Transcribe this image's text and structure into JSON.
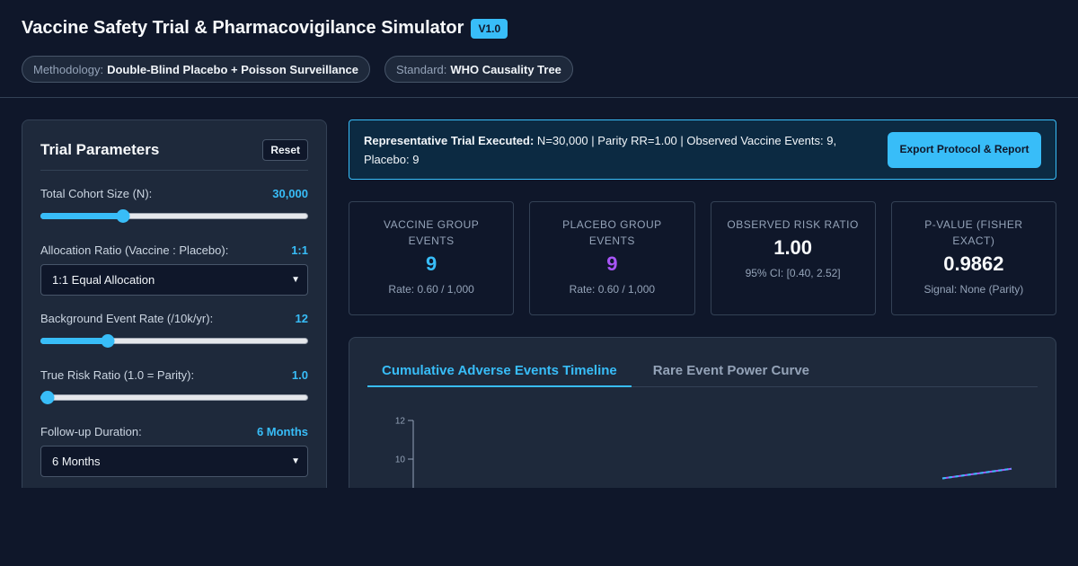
{
  "header": {
    "title": "Vaccine Safety Trial & Pharmacovigilance Simulator",
    "version": "V1.0",
    "pills": [
      {
        "label": "Methodology:",
        "value": "Double-Blind Placebo + Poisson Surveillance"
      },
      {
        "label": "Standard:",
        "value": "WHO Causality Tree"
      }
    ]
  },
  "sidebar": {
    "title": "Trial Parameters",
    "reset_label": "Reset",
    "params": {
      "cohort": {
        "label": "Total Cohort Size (N):",
        "value": "30,000",
        "fraction": 0.3
      },
      "allocation": {
        "label": "Allocation Ratio (Vaccine : Placebo):",
        "value": "1:1",
        "selected": "1:1 Equal Allocation"
      },
      "background": {
        "label": "Background Event Rate (/10k/yr):",
        "value": "12",
        "fraction": 0.24
      },
      "risk": {
        "label": "True Risk Ratio (1.0 = Parity):",
        "value": "1.0",
        "fraction": 0.0
      },
      "followup": {
        "label": "Follow-up Duration:",
        "value": "6 Months",
        "selected": "6 Months"
      }
    }
  },
  "banner": {
    "bold": "Representative Trial Executed:",
    "text": " N=30,000 | Parity RR=1.00 | Observed Vaccine Events: 9, Placebo: 9",
    "export_label": "Export Protocol & Report"
  },
  "cards": [
    {
      "label": "Vaccine Group Events",
      "value": "9",
      "sub": "Rate: 0.60 / 1,000",
      "color": "#38bdf8"
    },
    {
      "label": "Placebo Group Events",
      "value": "9",
      "sub": "Rate: 0.60 / 1,000",
      "color": "#a855f7"
    },
    {
      "label": "Observed Risk Ratio",
      "value": "1.00",
      "sub": "95% CI: [0.40, 2.52]",
      "color": "#f8fafc"
    },
    {
      "label": "P-Value (Fisher Exact)",
      "value": "0.9862",
      "sub": "Signal: None (Parity)",
      "color": "#f8fafc"
    }
  ],
  "tabs": [
    "Cumulative Adverse Events Timeline",
    "Rare Event Power Curve"
  ],
  "chart_data": {
    "type": "line",
    "y_ticks": [
      "12",
      "10"
    ],
    "ylim": [
      0,
      12
    ],
    "series": [
      {
        "values": [
          9.0,
          9.5
        ],
        "color": "#a855f7"
      },
      {
        "values": [
          9.0,
          9.5
        ],
        "color": "#38bdf8"
      }
    ]
  }
}
